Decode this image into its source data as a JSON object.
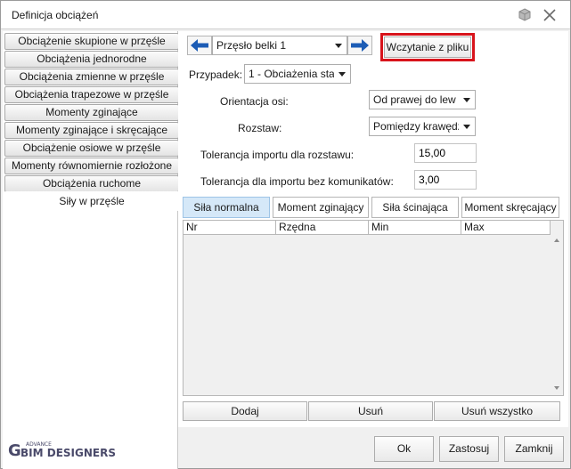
{
  "window": {
    "title": "Definicja obciążeń"
  },
  "left_list": {
    "items": [
      {
        "label": "Obciążenie skupione w przęśle"
      },
      {
        "label": "Obciążenia jednorodne"
      },
      {
        "label": "Obciążenia zmienne w przęśle"
      },
      {
        "label": "Obciążenia trapezowe w przęśle"
      },
      {
        "label": "Momenty zginające"
      },
      {
        "label": "Momenty zginające i skręcające"
      },
      {
        "label": "Obciążenie osiowe w przęśle"
      },
      {
        "label": "Momenty równomiernie rozłożone"
      },
      {
        "label": "Obciążenia ruchome"
      },
      {
        "label": "Siły w przęśle"
      }
    ],
    "selected_index": 9
  },
  "span": {
    "value": "Przęsło belki 1"
  },
  "import_button": "Wczytanie z pliku",
  "case": {
    "label": "Przypadek:",
    "value": "1 - Obciażenia sta"
  },
  "orientation": {
    "label": "Orientacja osi:",
    "value": "Od prawej do lew"
  },
  "spacing": {
    "label": "Rozstaw:",
    "value": "Pomiędzy krawędz"
  },
  "tolerance_spacing": {
    "label": "Tolerancja importu dla rozstawu:",
    "value": "15,00"
  },
  "tolerance_silent": {
    "label": "Tolerancja dla importu bez komunikatów:",
    "value": "3,00"
  },
  "tabs": [
    {
      "label": "Siła normalna",
      "active": true
    },
    {
      "label": "Moment zginający",
      "active": false
    },
    {
      "label": "Siła ścinająca",
      "active": false
    },
    {
      "label": "Moment skręcający",
      "active": false
    }
  ],
  "grid": {
    "columns": [
      "Nr",
      "Rzędna",
      "Min",
      "Max"
    ]
  },
  "grid_buttons": {
    "add": "Dodaj",
    "remove": "Usuń",
    "remove_all": "Usuń wszystko"
  },
  "footer": {
    "logo_small": "ADVANCE",
    "logo_main": "BIM DESIGNERS",
    "ok": "Ok",
    "apply": "Zastosuj",
    "close": "Zamknij"
  },
  "colors": {
    "highlight": "#d8141c",
    "arrow_blue": "#1c5cb5",
    "active_tab": "#d5e8f8",
    "logo": "#4a4a6a"
  }
}
